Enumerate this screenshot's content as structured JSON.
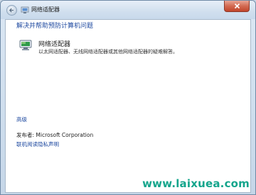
{
  "window": {
    "title": "网络适配器"
  },
  "main": {
    "heading": "解决并帮助预防计算机问题",
    "item": {
      "title": "网络适配器",
      "description": "以太网适配器、无线网络适配器或其他网络适配器的疑难解答。"
    },
    "advanced_link": "高级",
    "publisher": "发布者: Microsoft Corporation",
    "privacy_link": "联机阅读隐私声明"
  },
  "watermark": "www.laixuea.com",
  "colors": {
    "link": "#1f4aa0",
    "watermark": "#14a58c",
    "close_button": "#c1442a"
  }
}
